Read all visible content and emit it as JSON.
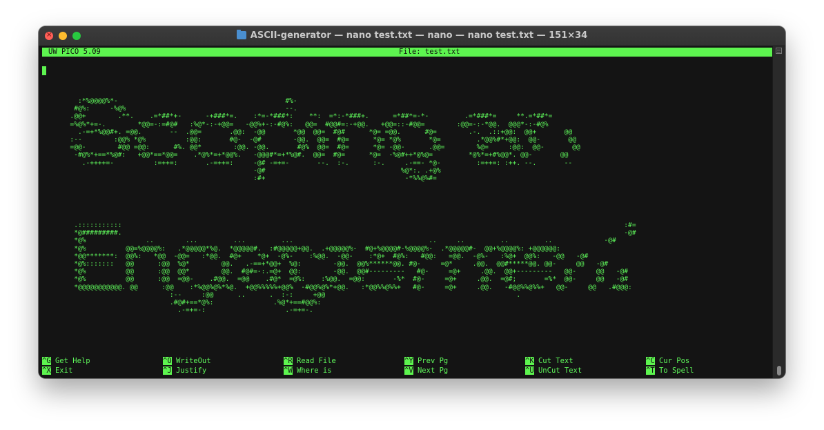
{
  "window": {
    "title": "ASCII-generator — nano test.txt — nano — nano test.txt — 151×34",
    "folder_icon": "folder-icon"
  },
  "nano": {
    "version": "UW PICO 5.09",
    "file": "File: test.txt"
  },
  "art": {
    "block1": "         :*%@@@@%*-                                          #%-\n        #@%:     -%@%                                        --.\n       .@@+        .**.    .=*##*+-      -+###*=.    :*=-*###*:    **:  =*:-*###+.      =*##*=-*-         .=*###*=     **.=*##*=\n       =%@%*+=-.        *@@=-:=#@#   :%@*-:-+@@=   -@@%+-:-#@%:   @@=  #@@#=:-+@@.   +@@=::-#@@=        :@@=-:-*@@.  @@@*-:-#@%\n         .-=+*%@@#+. =@@.       --  .@@=       .@@:  -@@       *@@  @@=  #@#      *@= =@@.      #@=        .-.  .::+@@:  @@+       @@\n       :--        :@@% *@%          :@@:       #@-  -@#        -@@.  @@=  #@=      *@= *@%       *@=         .*@@%#*+@@:  @@-       @@\n       =@@-        #@@ =@@:      #%. @@*        :@@. -@@.       #@%  @@=  #@=      *@= -@@-      .@@=        %@=     :@@:  @@-       @@\n        -#@%*+==*%@#:   +@@*==*@@=    .*@%*=+*@@%.   -@@@#*=+*%@#.  @@=  #@=      *@=  -%@#++*@%@=         *@%*=+#%@@*. @@-       @@\n          .-++++=-          :=++=:       .-=++=:     -@# -=+=-       --.  :-.      :-.     .-==- *@-         :=++=: :++. --.       --\n                                                     -@#                                  %@*:. .+@%\n                                                     :#+                                   -*%%@%#=",
    "block2": "        .:::::::::::                                                                                                                              :#=\n        *@#########.                                                                                                                              -@#\n        *@%               ..        ...         ...         ...                                  ..     ..         ..         ..             -@#\n        *@%          @@=%@@@@%:   .*@@@@@*%@.  *@@@@@#.  :#@@@@@+@@.  .+@@@@@%-  #@+%@@@@#-%@@@@%-  .*@@@@@#-  @@+%@@@@%: +@@@@@@:\n        *@@*******:  @@%:   *@@  -@@=   :*@@.  #@+    *@+  -@%-    :%@@.  -@@-    :*@+  #@%:   #@@:   =@@.  -@%-   :%@+  @@%:   -@@   -@#\n        *@%:::::::   @@      :@@  %@*        @@.   .-==+*@@+  %@:        -@@.  @@%******@@. #@-     =@*     .@@.  @@#*****@@. @@-     @@   -@#\n        *@%          @@      :@@  @@*        @@.  #@#=-:.=@+  @@:        -@@.  @@#---------   #@-     =@+     .@@.  @@+---------   @@-     @@   -@#\n        *@%          @@      :@@  =@@-    .#@@.  =@@    .#@*  =@%:    :%@@.  =@@:       -%*  #@-     =@+     .@@.  =@#;       =%*  @@-     @@   -@#\n        *@@@@@@@@@@@. @@      :@@    :*%@@%@%*%@.  +@@%%%%%+@@%  -#@@%@%*+@@.   :*@@%%@%%+   #@-     =@+     .@@.   -#@@%%@%%+   @@-     @@   .#@@@:\n                                :--     :@@      ..      .  :-:     +@@                                                .\n                                .#@#+==*@%:               .%@*+==#@@%:\n                                  .-=+=-:                    .-=+=-."
  },
  "help": [
    {
      "key": "^G",
      "label": "Get Help"
    },
    {
      "key": "^X",
      "label": "Exit"
    },
    {
      "key": "^O",
      "label": "WriteOut"
    },
    {
      "key": "^J",
      "label": "Justify"
    },
    {
      "key": "^R",
      "label": "Read File"
    },
    {
      "key": "^W",
      "label": "Where is"
    },
    {
      "key": "^Y",
      "label": "Prev Pg"
    },
    {
      "key": "^V",
      "label": "Next Pg"
    },
    {
      "key": "^K",
      "label": "Cut Text"
    },
    {
      "key": "^U",
      "label": "UnCut Text"
    },
    {
      "key": "^C",
      "label": "Cur Pos"
    },
    {
      "key": "^T",
      "label": "To Spell"
    }
  ],
  "colors": {
    "terminal_bg": "#141414",
    "terminal_fg": "#5ef55a",
    "header_bg": "#5df44f"
  }
}
